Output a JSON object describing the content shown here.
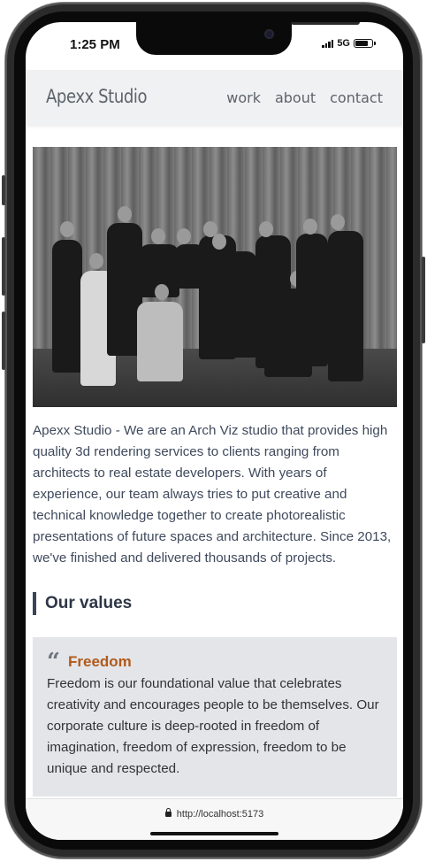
{
  "status_bar": {
    "time": "1:25 PM",
    "network": "5G",
    "battery_level": 0.85
  },
  "header": {
    "brand": "Apexx Studio",
    "nav": [
      "work",
      "about",
      "contact"
    ]
  },
  "intro_text": "Apexx Studio - We are an Arch Viz studio that provides high quality 3d rendering services to clients ranging from architects to real estate developers. With years of experience, our team always tries to put creative and technical knowledge together to create photorealistic presentations of future spaces and architecture. Since 2013, we've finished and delivered thousands of projects.",
  "values": {
    "section_title": "Our values",
    "items": [
      {
        "title": "Freedom",
        "text": "Freedom is our foundational value that celebrates creativity and encourages people to be themselves. Our corporate culture is deep-rooted in freedom of imagination, freedom of expression, freedom to be unique and respected."
      }
    ]
  },
  "browser": {
    "url": "http://localhost:5173"
  },
  "icons": {
    "quote": "quote-icon",
    "lock": "lock-icon",
    "camera": "front-camera-icon"
  },
  "colors": {
    "accent": "#b05a1c",
    "text": "#3f4a5c",
    "header_bg": "#f0f1f3",
    "card_bg": "#e4e5e8"
  }
}
